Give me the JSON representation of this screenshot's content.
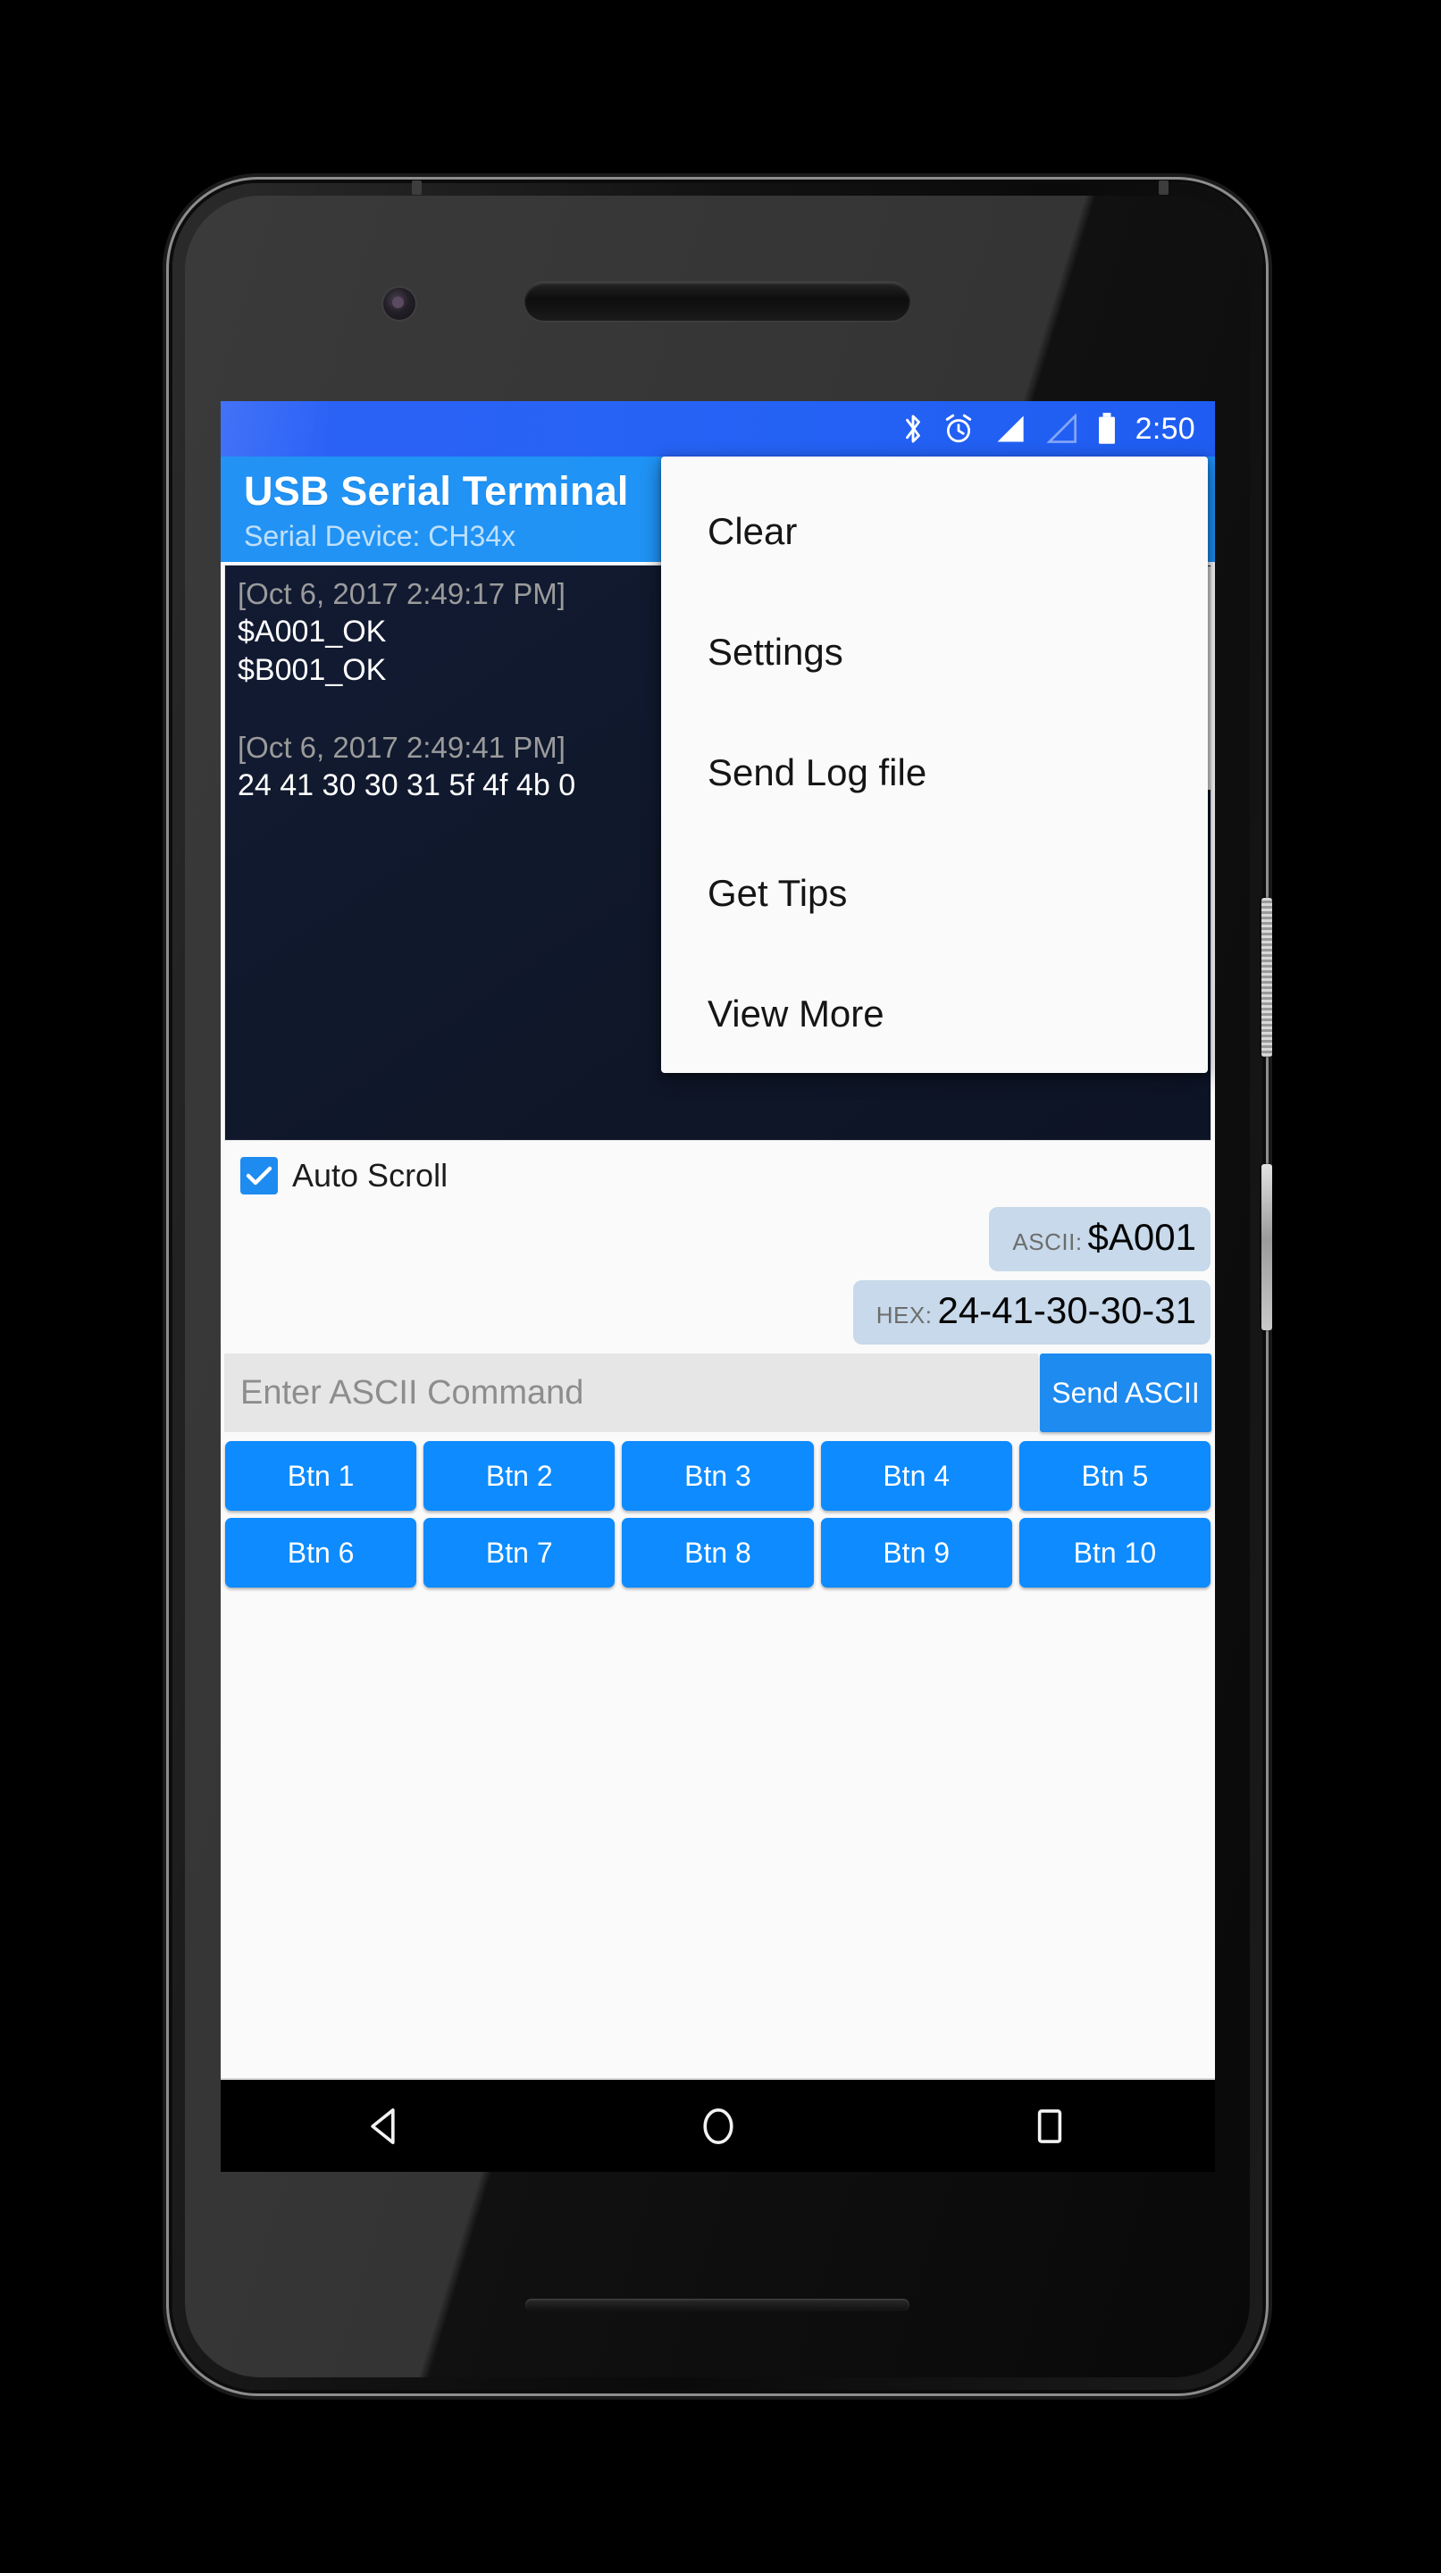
{
  "status_bar": {
    "icons": [
      "bluetooth-icon",
      "alarm-icon",
      "signal-full-icon",
      "signal-empty-icon",
      "battery-icon"
    ],
    "clock": "2:50",
    "background_color": "#2663f5"
  },
  "app_bar": {
    "title": "USB Serial Terminal",
    "subtitle": "Serial Device: CH34x",
    "background_color": "#1e93f6",
    "subtitle_color": "#bfe0fd"
  },
  "terminal": {
    "background_color": "#0f1729",
    "lines": [
      {
        "type": "timestamp",
        "text": "[Oct 6, 2017 2:49:17 PM]"
      },
      {
        "type": "data",
        "text": "$A001_OK"
      },
      {
        "type": "data",
        "text": "$B001_OK"
      },
      {
        "type": "gap",
        "text": ""
      },
      {
        "type": "timestamp",
        "text": "[Oct 6, 2017 2:49:41 PM]"
      },
      {
        "type": "data",
        "text": "24 41 30 30 31 5f 4f 4b 0"
      }
    ]
  },
  "auto_scroll": {
    "label": "Auto Scroll",
    "checked": true,
    "check_color": "#1e8bf0"
  },
  "chips": [
    {
      "key": "ASCII:",
      "value": "$A001"
    },
    {
      "key": "HEX:",
      "value": "24-41-30-30-31"
    }
  ],
  "command_row": {
    "input_placeholder": "Enter ASCII Command",
    "input_value": "",
    "send_button_label": "Send ASCII",
    "send_button_color": "#1e8bf0"
  },
  "button_grid": {
    "button_color": "#0d8bff",
    "buttons": [
      "Btn 1",
      "Btn 2",
      "Btn 3",
      "Btn 4",
      "Btn 5",
      "Btn 6",
      "Btn 7",
      "Btn 8",
      "Btn 9",
      "Btn 10"
    ]
  },
  "overflow_menu": {
    "items": [
      "Clear",
      "Settings",
      "Send Log file",
      "Get Tips",
      "View More"
    ]
  },
  "nav_bar": {
    "icons": [
      "back-icon",
      "home-icon",
      "recents-icon"
    ]
  }
}
